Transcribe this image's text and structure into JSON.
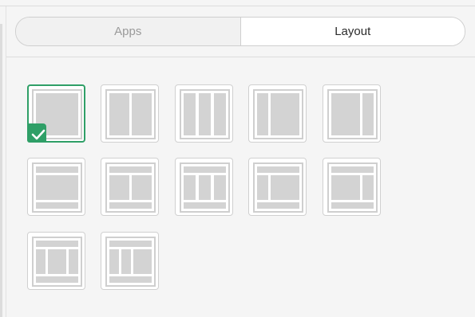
{
  "tabs": [
    {
      "label": "Apps",
      "active": false
    },
    {
      "label": "Layout",
      "active": true
    }
  ],
  "colors": {
    "accent": "#2f9f67",
    "tile_fill": "#d3d3d3",
    "tile_border": "#d0d0d0",
    "background": "#f5f5f5"
  },
  "layouts": [
    {
      "name": "single-column",
      "selected": true
    },
    {
      "name": "two-column-equal",
      "selected": false
    },
    {
      "name": "three-column",
      "selected": false
    },
    {
      "name": "two-column-wide-right",
      "selected": false
    },
    {
      "name": "two-column-wide-left",
      "selected": false
    },
    {
      "name": "header-single-footer",
      "selected": false
    },
    {
      "name": "header-two-column-footer",
      "selected": false
    },
    {
      "name": "header-three-column-footer",
      "selected": false
    },
    {
      "name": "header-wide-right-footer",
      "selected": false
    },
    {
      "name": "header-wide-left-footer",
      "selected": false
    },
    {
      "name": "header-narrow-wide-narrow-footer",
      "selected": false
    },
    {
      "name": "header-wide-narrow-footer",
      "selected": false
    }
  ],
  "selected_icon": "checkmark-icon"
}
